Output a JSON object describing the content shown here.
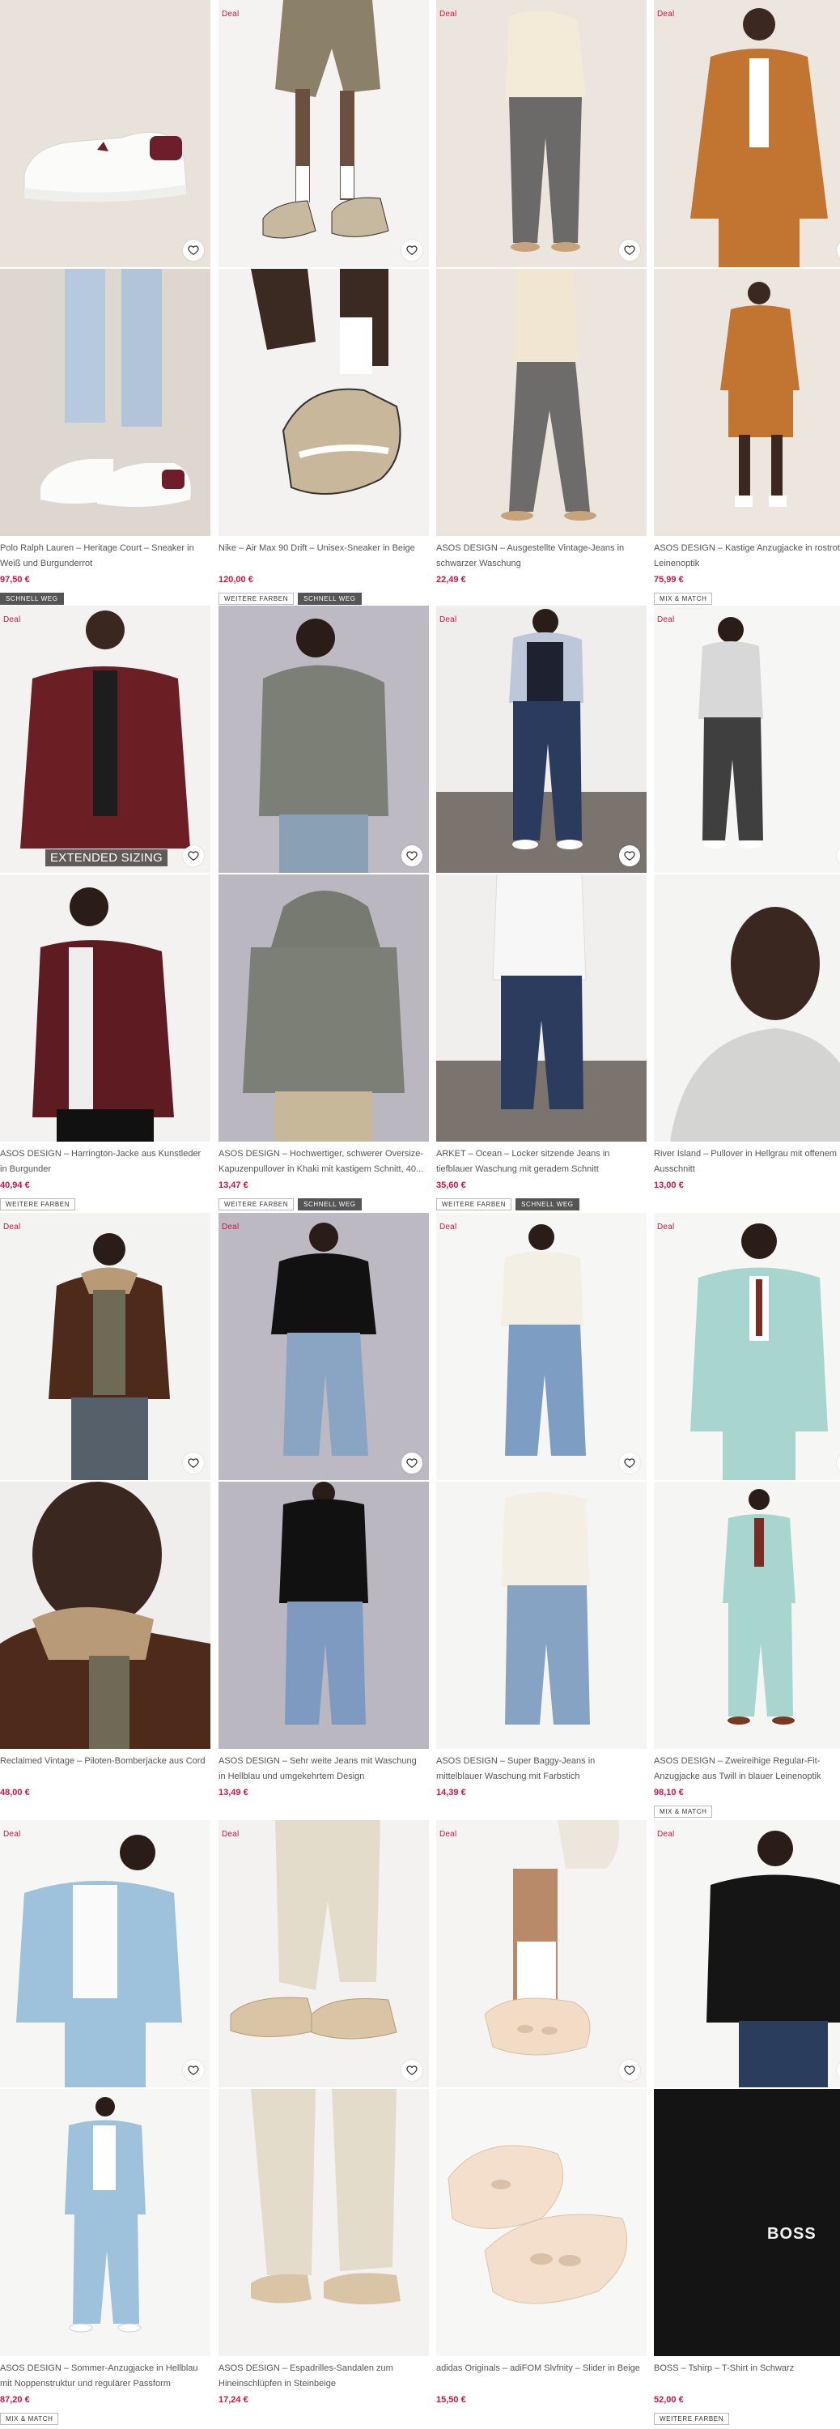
{
  "products": [
    {
      "deal": "",
      "title": "Polo Ralph Lauren – Heritage Court – Sneaker in Weiß und Burgunderrot",
      "price": "97,50 €",
      "badges": [
        {
          "label": "SCHNELL WEG",
          "dark": true
        }
      ],
      "sizing": ""
    },
    {
      "deal": "Deal",
      "title": "Nike – Air Max 90 Drift – Unisex-Sneaker in Beige",
      "price": "120,00 €",
      "badges": [
        {
          "label": "WEITERE FARBEN",
          "dark": false
        },
        {
          "label": "SCHNELL WEG",
          "dark": true
        }
      ],
      "sizing": ""
    },
    {
      "deal": "Deal",
      "title": "ASOS DESIGN – Ausgestellte Vintage-Jeans in schwarzer Waschung",
      "price": "22,49 €",
      "badges": [],
      "sizing": ""
    },
    {
      "deal": "Deal",
      "title": "ASOS DESIGN – Kastige Anzugjacke in rostrot Leinenoptik",
      "price": "75,99 €",
      "badges": [
        {
          "label": "MIX & MATCH",
          "dark": false
        }
      ],
      "sizing": ""
    },
    {
      "deal": "Deal",
      "title": "ASOS DESIGN – Harrington-Jacke aus Kunstleder in Burgunder",
      "price": "40,94 €",
      "badges": [
        {
          "label": "WEITERE FARBEN",
          "dark": false
        }
      ],
      "sizing": "EXTENDED SIZING"
    },
    {
      "deal": "",
      "title": "ASOS DESIGN – Hochwertiger, schwerer Oversize-Kapuzenpullover in Khaki mit kastigem Schnitt, 40...",
      "price": "13,47 €",
      "badges": [
        {
          "label": "WEITERE FARBEN",
          "dark": false
        },
        {
          "label": "SCHNELL WEG",
          "dark": true
        }
      ],
      "sizing": ""
    },
    {
      "deal": "Deal",
      "title": "ARKET – Ocean – Locker sitzende Jeans in tiefblauer Waschung mit geradem Schnitt",
      "price": "35,60 €",
      "badges": [
        {
          "label": "WEITERE FARBEN",
          "dark": false
        },
        {
          "label": "SCHNELL WEG",
          "dark": true
        }
      ],
      "sizing": ""
    },
    {
      "deal": "Deal",
      "title": "River Island – Pullover in Hellgrau mit offenem Ausschnitt",
      "price": "13,00 €",
      "badges": [],
      "sizing": ""
    },
    {
      "deal": "Deal",
      "title": "Reclaimed Vintage – Piloten-Bomberjacke aus Cord",
      "price": "48,00 €",
      "badges": [],
      "sizing": ""
    },
    {
      "deal": "Deal",
      "title": "ASOS DESIGN – Sehr weite Jeans mit Waschung in Hellblau und umgekehrtem Design",
      "price": "13,49 €",
      "badges": [],
      "sizing": ""
    },
    {
      "deal": "Deal",
      "title": "ASOS DESIGN – Super Baggy-Jeans in mittelblauer Waschung mit Farbstich",
      "price": "14,39 €",
      "badges": [],
      "sizing": ""
    },
    {
      "deal": "Deal",
      "title": "ASOS DESIGN – Zweireihige Regular-Fit-Anzugjacke aus Twill in blauer Leinenoptik",
      "price": "98,10 €",
      "badges": [
        {
          "label": "MIX & MATCH",
          "dark": false
        }
      ],
      "sizing": ""
    },
    {
      "deal": "Deal",
      "title": "ASOS DESIGN – Sommer-Anzugjacke in Hellblau mit Noppenstruktur und regulärer Passform",
      "price": "87,20 €",
      "badges": [
        {
          "label": "MIX & MATCH",
          "dark": false
        }
      ],
      "sizing": ""
    },
    {
      "deal": "Deal",
      "title": "ASOS DESIGN – Espadrilles-Sandalen zum Hineinschlüpfen in Steinbeige",
      "price": "17,24 €",
      "badges": [],
      "sizing": ""
    },
    {
      "deal": "Deal",
      "title": "adidas Originals – adiFOM Slvfnity – Slider in Beige",
      "price": "15,50 €",
      "badges": [],
      "sizing": ""
    },
    {
      "deal": "Deal",
      "title": "BOSS – Tshirp – T-Shirt in Schwarz",
      "price": "52,00 €",
      "badges": [
        {
          "label": "WEITERE FARBEN",
          "dark": false
        }
      ],
      "sizing": ""
    }
  ],
  "print_text": {
    "boss_logo": "BOSS"
  },
  "icons": {
    "wishlist": "heart-icon"
  },
  "colors": {
    "deal": "#d01345",
    "price": "#d01345",
    "badge_dark": "#555555"
  }
}
